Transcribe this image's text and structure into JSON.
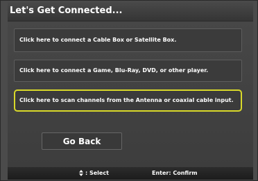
{
  "window": {
    "title": "Let's Get Connected..."
  },
  "options": [
    {
      "label": "Click here to connect a Cable Box or Satellite Box."
    },
    {
      "label": "Click here to connect a Game, Blu-Ray, DVD, or other player."
    },
    {
      "label": "Click here to scan channels from the Antenna or coaxial cable input."
    }
  ],
  "buttons": {
    "go_back": "Go Back"
  },
  "statusbar": {
    "select_hint": ": Select",
    "select_icon": "up-down-arrows-icon",
    "confirm_hint": "Enter: Confirm"
  },
  "colors": {
    "focus_outline": "#d9d92a",
    "background": "#3f3f3f",
    "text": "#ffffff"
  }
}
